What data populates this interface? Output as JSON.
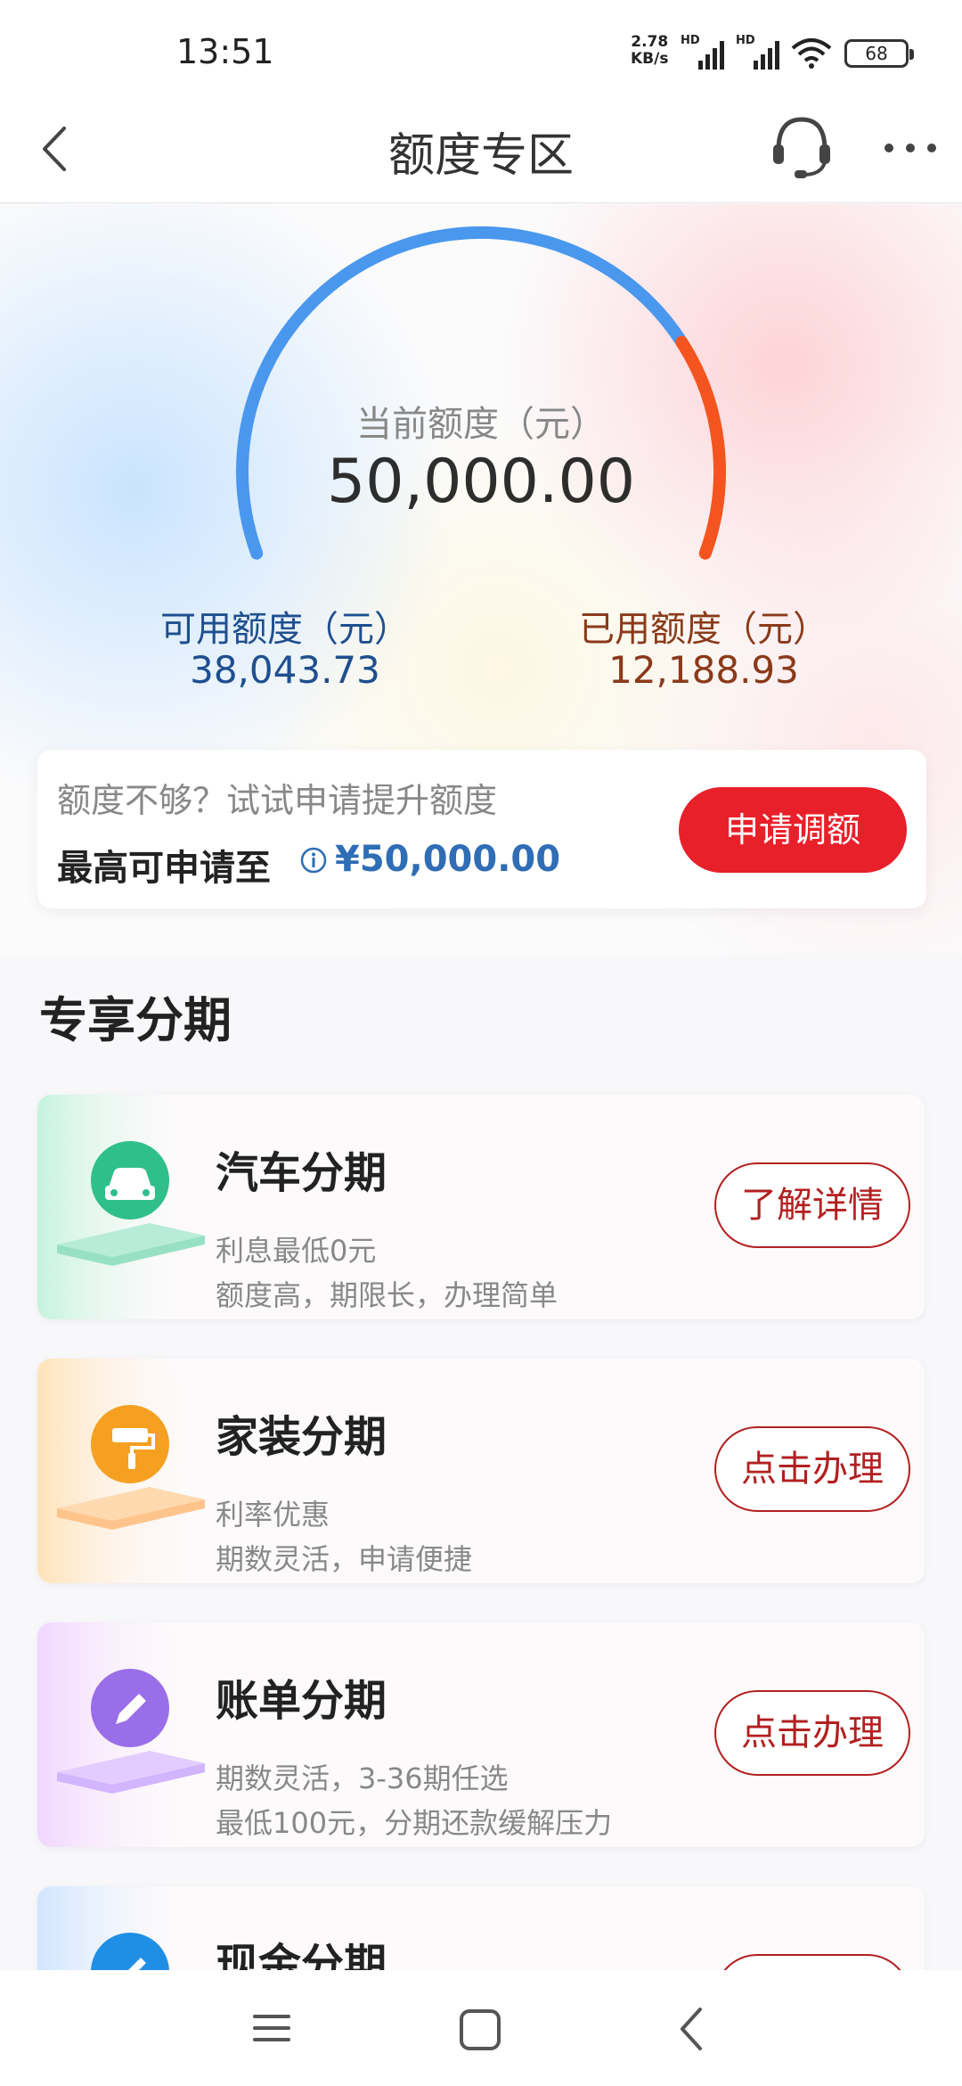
{
  "status_bar": {
    "time": "13:51",
    "net_speed_value": "2.78",
    "net_speed_unit": "KB/s",
    "signal_tag": "HD",
    "battery": "68"
  },
  "nav": {
    "title": "额度专区",
    "icons": [
      "back-icon",
      "headset-icon",
      "more-icon"
    ]
  },
  "credit": {
    "current_label": "当前额度（元）",
    "current_value": "50,000.00",
    "available_label": "可用额度（元）",
    "available_value": "38,043.73",
    "used_label": "已用额度（元）",
    "used_value": "12,188.93",
    "used_fraction": 0.24,
    "colors": {
      "available": "#4a97ee",
      "used": "#f4541f"
    }
  },
  "limit_card": {
    "hint": "额度不够？试试申请提升额度",
    "max_label": "最高可申请至",
    "max_value": "¥50,000.00",
    "button": "申请调额"
  },
  "section": {
    "title": "专享分期",
    "items": [
      {
        "title": "汽车分期",
        "line1": "利息最低0元",
        "line2": "额度高，期限长，办理简单",
        "button": "了解详情",
        "icon": "car-icon",
        "color": "#2fbf8a"
      },
      {
        "title": "家装分期",
        "line1": "利率优惠",
        "line2": "期数灵活，申请便捷",
        "button": "点击办理",
        "icon": "paint-roller-icon",
        "color": "#f5a021"
      },
      {
        "title": "账单分期",
        "line1": "期数灵活，3-36期任选",
        "line2": "最低100元，分期还款缓解压力",
        "button": "点击办理",
        "icon": "pencil-icon",
        "color": "#9a6ee8"
      },
      {
        "title": "现金分期",
        "icon": "rocket-icon",
        "color": "#1f8fe6"
      }
    ]
  }
}
